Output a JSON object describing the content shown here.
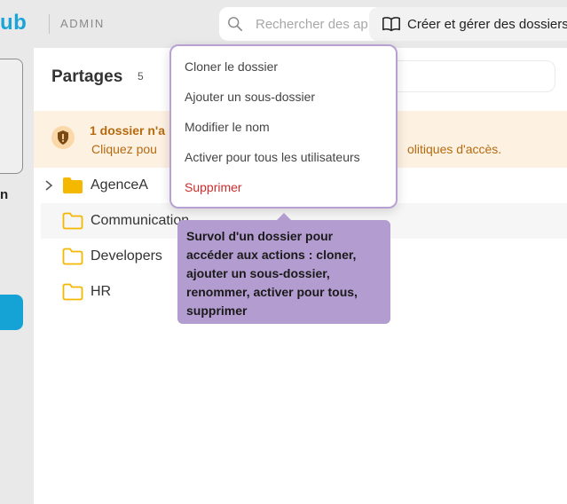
{
  "topbar": {
    "logo_text": "ub",
    "admin_label": "ADMIN",
    "search_placeholder": "Rechercher des ap",
    "guide_label": "Créer et gérer des dossiers",
    "icons": {
      "search": "search-icon",
      "guide": "book-icon"
    }
  },
  "rail": {
    "letter": "n"
  },
  "main": {
    "title": "Partages",
    "count": "5"
  },
  "warning": {
    "line1": "1 dossier n'a",
    "line2_start": "Cliquez pou",
    "line2_end": "olitiques d'accès."
  },
  "folders": [
    {
      "label": "AgenceA",
      "expandable": true,
      "filled": true
    },
    {
      "label": "Communication",
      "expandable": false,
      "filled": false
    },
    {
      "label": "Developers",
      "expandable": false,
      "filled": false
    },
    {
      "label": "HR",
      "expandable": false,
      "filled": false
    }
  ],
  "context_menu": {
    "items": [
      {
        "label": "Cloner le dossier"
      },
      {
        "label": "Ajouter un sous-dossier"
      },
      {
        "label": "Modifier le nom"
      },
      {
        "label": "Activer pour tous les utilisateurs"
      },
      {
        "label": "Supprimer",
        "danger": true
      }
    ]
  },
  "tooltip": {
    "text": "Survol d'un dossier pour accéder aux actions : cloner, ajouter un sous-dossier, renommer, activer pour tous, supprimer"
  },
  "colors": {
    "brand": "#1aa4d8",
    "folder": "#f5b800",
    "warning_text": "#b66a10",
    "warning_bg": "#fdf1e2",
    "tooltip_bg": "#b39ccf",
    "danger": "#cc2d2d"
  }
}
